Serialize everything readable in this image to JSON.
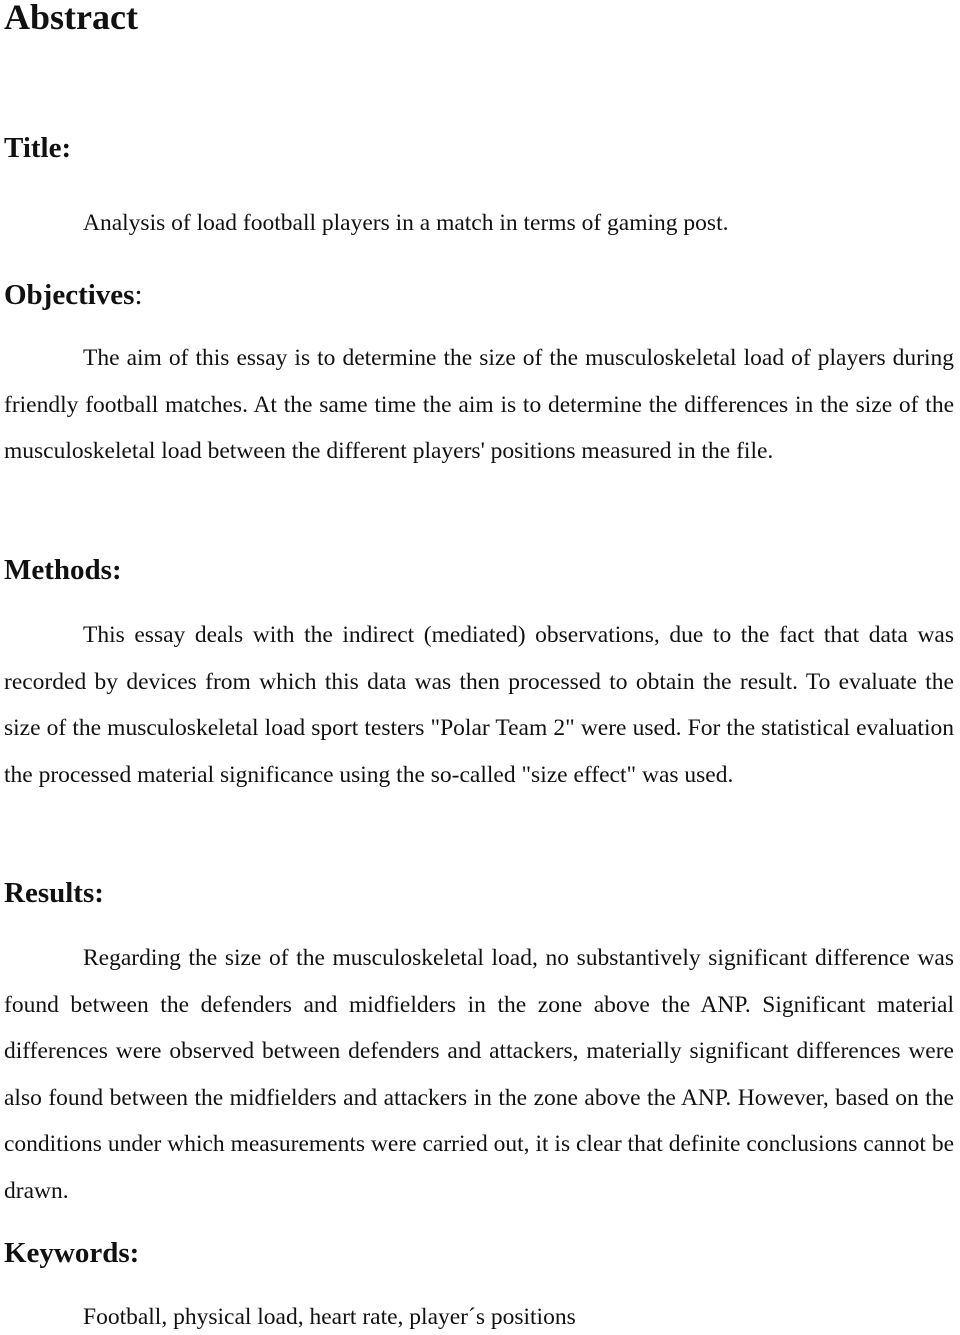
{
  "document": {
    "title": "Abstract",
    "sections": {
      "title": {
        "heading": "Title",
        "colon": ":",
        "text": "Analysis of load football players in a match in terms of gaming post."
      },
      "objectives": {
        "heading": "Objectives",
        "colon": ":",
        "text": "The aim of this essay is to determine the size of the musculoskeletal load of players during friendly football matches. At the same time the aim is to determine the differences in the size of the musculoskeletal load between the different players' positions measured in the file."
      },
      "methods": {
        "heading": "Methods",
        "colon": ":",
        "text": "This essay deals with the indirect (mediated) observations, due to the fact that data was recorded by devices from which this data was then processed to obtain the result. To evaluate the size of the musculoskeletal load sport testers \"Polar Team 2\" were used. For the statistical evaluation the processed material significance using the so-called \"size effect\" was used."
      },
      "results": {
        "heading": "Results",
        "colon": ":",
        "text": "Regarding the size of the musculoskeletal load, no substantively significant difference was found between the defenders and midfielders in the zone above the ANP. Significant material differences were observed between defenders and attackers, materially significant differences were also found between the midfielders and attackers in the zone above the ANP. However, based on the conditions under which measurements were carried out, it is clear that definite conclusions cannot be drawn."
      },
      "keywords": {
        "heading": "Keywords",
        "colon": ":",
        "text": "Football, physical load, heart rate, player´s positions"
      }
    }
  }
}
